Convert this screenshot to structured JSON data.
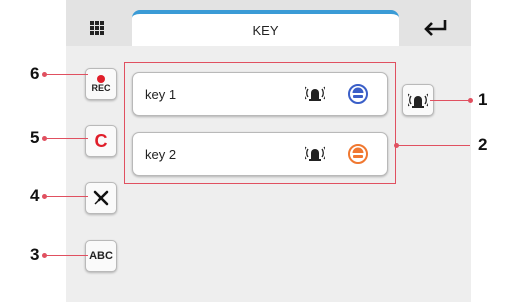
{
  "header": {
    "title": "KEY"
  },
  "keys": [
    {
      "label": "key 1",
      "color": "#3a5fc8"
    },
    {
      "label": "key 2",
      "color": "#f07830"
    }
  ],
  "side_buttons": {
    "rec": "REC",
    "cancel": "C",
    "abc": "ABC"
  },
  "callouts": [
    "1",
    "2",
    "3",
    "4",
    "5",
    "6"
  ],
  "colors": {
    "accent": "#3a9bd6",
    "callout": "#e05060",
    "rec_dot": "#e01e2a"
  }
}
